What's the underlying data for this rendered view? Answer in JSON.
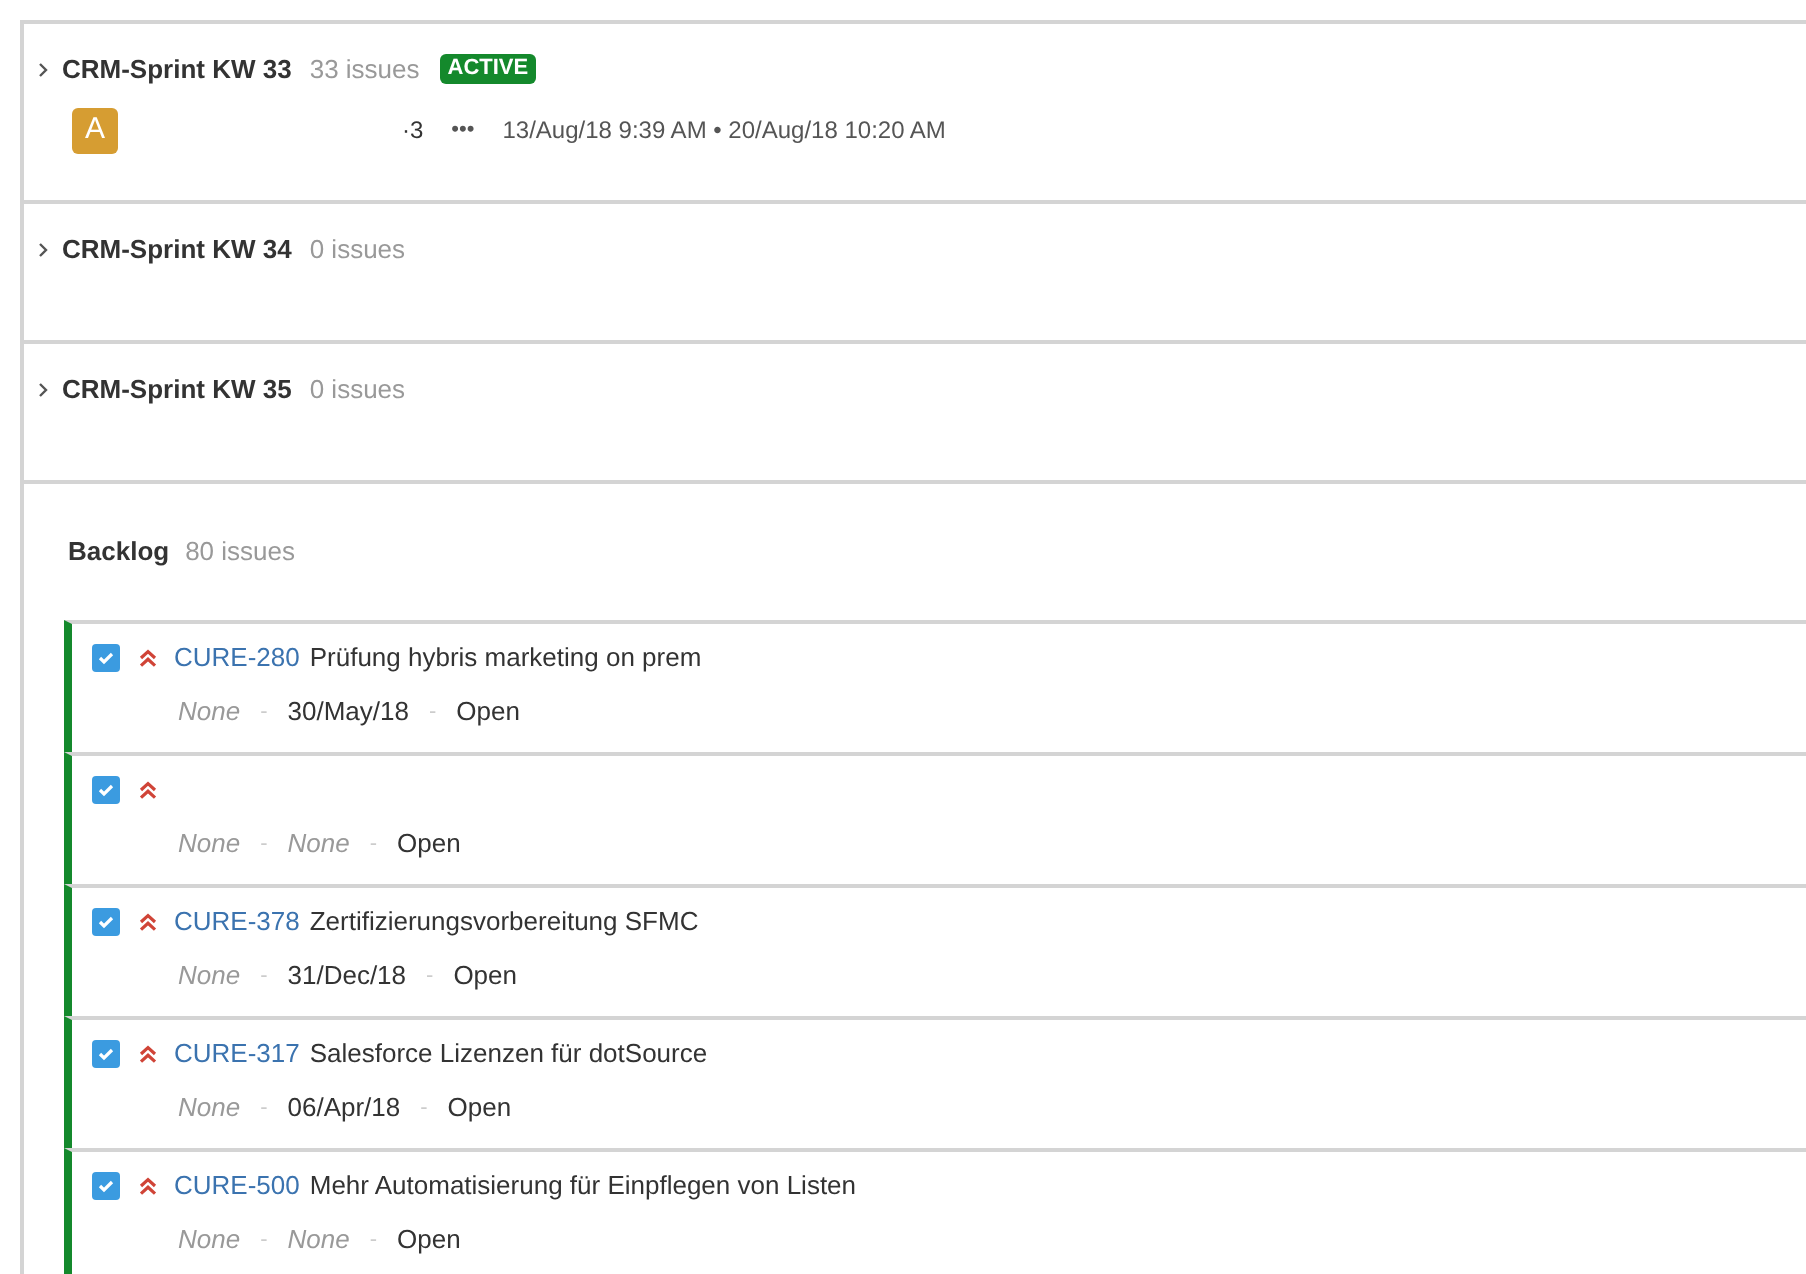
{
  "sprints": [
    {
      "name": "CRM-Sprint KW 33",
      "count": "33 issues",
      "badge": "ACTIVE",
      "expanded": false,
      "details": {
        "avatar": "A",
        "number": "·3",
        "more": "•••",
        "dates": "13/Aug/18 9:39 AM • 20/Aug/18 10:20 AM"
      }
    },
    {
      "name": "CRM-Sprint KW 34",
      "count": "0 issues",
      "expanded": false
    },
    {
      "name": "CRM-Sprint KW 35",
      "count": "0 issues",
      "expanded": false
    }
  ],
  "backlog": {
    "name": "Backlog",
    "count": "80 issues",
    "issues": [
      {
        "checked": true,
        "key": "CURE-280",
        "summary": "Prüfung hybris marketing on prem",
        "meta": [
          {
            "kind": "empty",
            "text": "None"
          },
          {
            "kind": "sep",
            "text": "-"
          },
          {
            "kind": "value",
            "text": "30/May/18"
          },
          {
            "kind": "sep",
            "text": "-"
          },
          {
            "kind": "value",
            "text": "Open"
          }
        ]
      },
      {
        "checked": true,
        "meta": [
          {
            "kind": "empty",
            "text": "None"
          },
          {
            "kind": "sep",
            "text": "-"
          },
          {
            "kind": "empty",
            "text": "None"
          },
          {
            "kind": "sep",
            "text": "-"
          },
          {
            "kind": "value",
            "text": "Open"
          }
        ]
      },
      {
        "checked": true,
        "key": "CURE-378",
        "summary": "Zertifizierungsvorbereitung SFMC",
        "meta": [
          {
            "kind": "empty",
            "text": "None"
          },
          {
            "kind": "sep",
            "text": "-"
          },
          {
            "kind": "value",
            "text": "31/Dec/18"
          },
          {
            "kind": "sep",
            "text": "-"
          },
          {
            "kind": "value",
            "text": "Open"
          }
        ]
      },
      {
        "checked": true,
        "key": "CURE-317",
        "summary": "Salesforce Lizenzen für dotSource",
        "meta": [
          {
            "kind": "empty",
            "text": "None"
          },
          {
            "kind": "sep",
            "text": "-"
          },
          {
            "kind": "value",
            "text": "06/Apr/18"
          },
          {
            "kind": "sep",
            "text": "-"
          },
          {
            "kind": "value",
            "text": "Open"
          }
        ]
      },
      {
        "checked": true,
        "key": "CURE-500",
        "summary": "Mehr Automatisierung für Einpflegen von Listen",
        "meta": [
          {
            "kind": "empty",
            "text": "None"
          },
          {
            "kind": "sep",
            "text": "-"
          },
          {
            "kind": "empty",
            "text": "None"
          },
          {
            "kind": "sep",
            "text": "-"
          },
          {
            "kind": "value",
            "text": "Open"
          }
        ]
      }
    ]
  }
}
